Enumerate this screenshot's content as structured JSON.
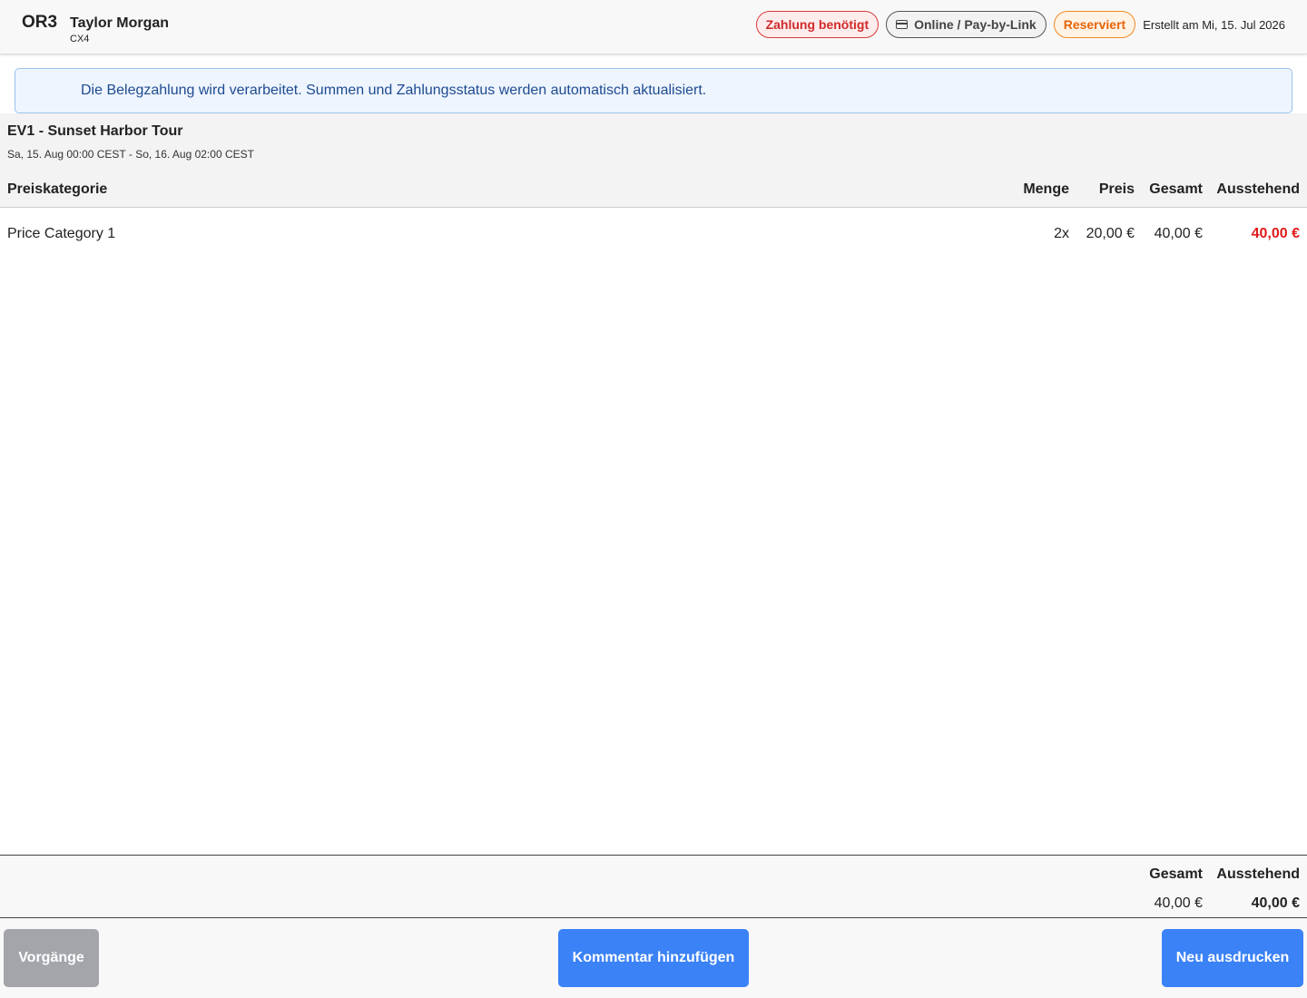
{
  "header": {
    "order_id": "OR3",
    "customer_name": "Taylor Morgan",
    "customer_id": "CX4",
    "badges": {
      "payment": "Zahlung benötigt",
      "online": "Online / Pay-by-Link",
      "reserved": "Reserviert"
    },
    "created": "Erstellt am Mi, 15. Jul 2026"
  },
  "info_banner": {
    "text": "Die Belegzahlung wird verarbeitet. Summen und Zahlungsstatus werden automatisch aktualisiert."
  },
  "event": {
    "title": "EV1 - Sunset Harbor Tour",
    "date": "Sa, 15. Aug 00:00 CEST - So, 16. Aug 02:00 CEST"
  },
  "table": {
    "headers": {
      "category": "Preiskategorie",
      "quantity": "Menge",
      "price": "Preis",
      "total": "Gesamt",
      "outstanding": "Ausstehend"
    },
    "rows": [
      {
        "category": "Price Category 1",
        "quantity": "2x",
        "price": "20,00 €",
        "total": "40,00 €",
        "outstanding": "40,00 €"
      }
    ]
  },
  "totals": {
    "total_label": "Gesamt",
    "outstanding_label": "Ausstehend",
    "total_value": "40,00 €",
    "outstanding_value": "40,00 €"
  },
  "footer": {
    "history_button": "Vorgänge",
    "comment_button": "Kommentar hinzufügen",
    "reprint_button": "Neu ausdrucken"
  },
  "colors": {
    "accent_blue": "#3b82f6",
    "outstanding_red": "#e01b1b",
    "reserved_orange": "#e8650a"
  },
  "icons": {
    "payment_method": "credit-card-icon"
  }
}
